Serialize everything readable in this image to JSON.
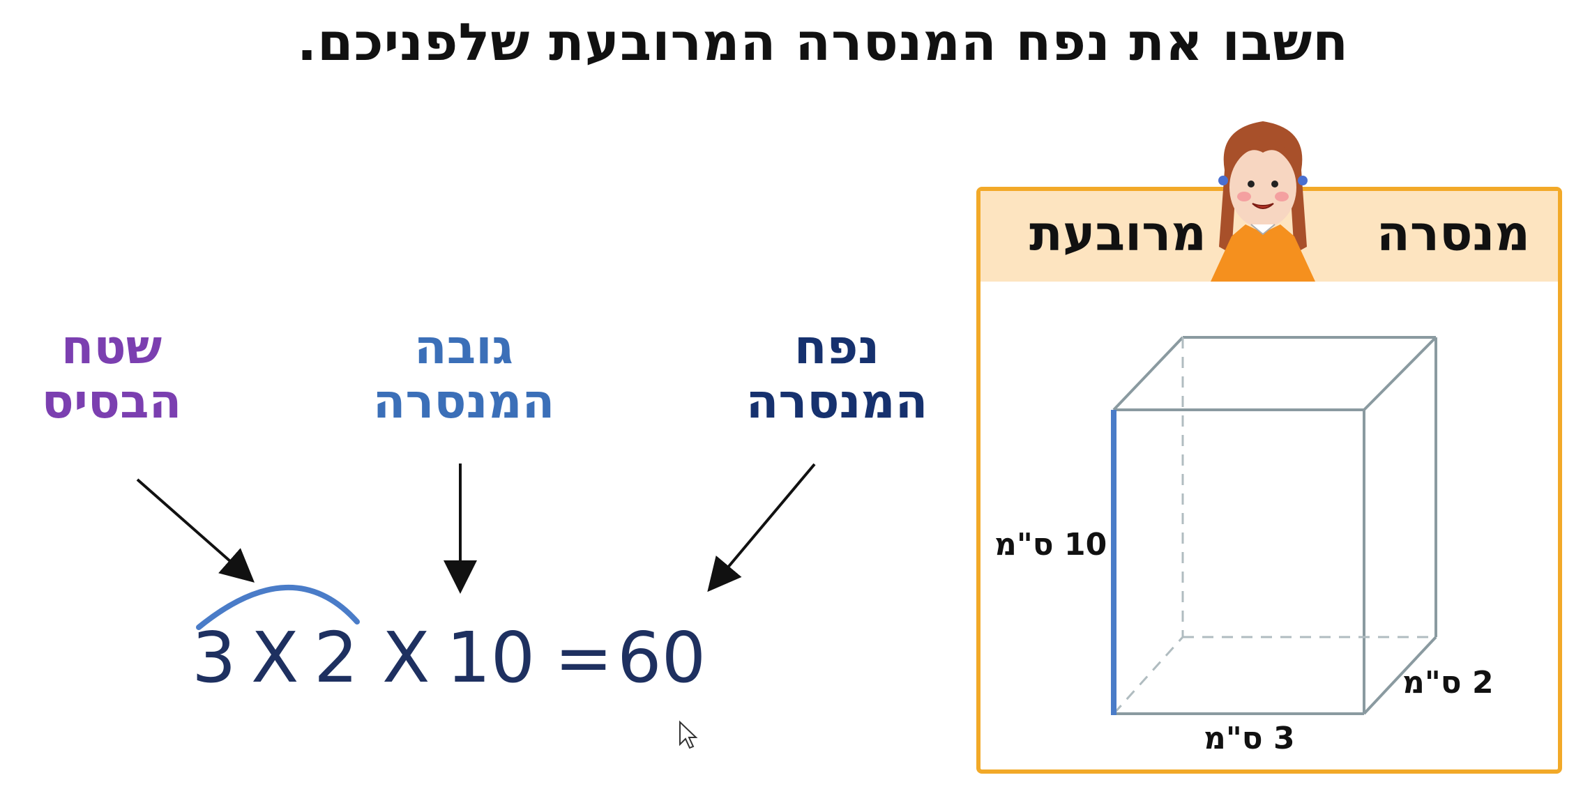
{
  "title": "חשבו את נפח המנסרה המרובעת שלפניכם.",
  "labels": {
    "base_area": {
      "line1": "שטח",
      "line2": "הבסיס"
    },
    "prism_height": {
      "line1": "גובה",
      "line2": "המנסרה"
    },
    "prism_volume": {
      "line1": "נפח",
      "line2": "המנסרה"
    }
  },
  "equation": {
    "a": "3",
    "times1": "X",
    "b": "2",
    "times2": "X",
    "c": "10",
    "equals": "=",
    "result": "60"
  },
  "card": {
    "word_right": "מנסרה",
    "word_left": "מרובעת",
    "dims": {
      "height": "10 ס\"מ",
      "width": "3 ס\"מ",
      "depth": "2 ס\"מ"
    }
  },
  "colors": {
    "base_area": "#7b3fb0",
    "prism_height": "#3b6fb8",
    "prism_volume": "#16316e",
    "frame": "#f2a928",
    "band": "#fde4c0"
  }
}
